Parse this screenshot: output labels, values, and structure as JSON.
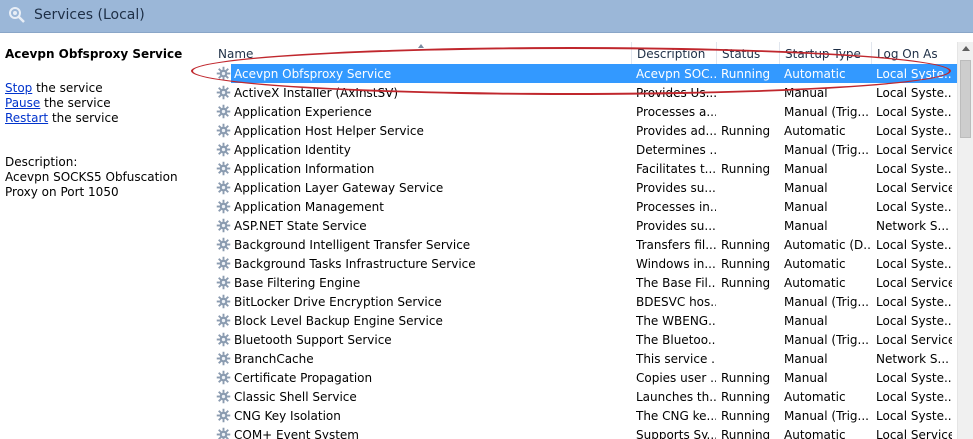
{
  "window": {
    "title": "Services (Local)"
  },
  "left_pane": {
    "heading": "Acevpn Obfsproxy Service",
    "actions": [
      {
        "link": "Stop",
        "rest": " the service"
      },
      {
        "link": "Pause",
        "rest": " the service"
      },
      {
        "link": "Restart",
        "rest": " the service"
      }
    ],
    "description_label": "Description:",
    "description_text": "Acevpn SOCKS5 Obfuscation Proxy on Port 1050"
  },
  "columns": {
    "name": "Name",
    "description": "Description",
    "status": "Status",
    "startup": "Startup Type",
    "logon": "Log On As"
  },
  "services": [
    {
      "name": "Acevpn Obfsproxy Service",
      "description": "Acevpn SOC...",
      "status": "Running",
      "startup": "Automatic",
      "logon": "Local Syste..."
    },
    {
      "name": "ActiveX Installer (AxInstSV)",
      "description": "Provides Us...",
      "status": "",
      "startup": "Manual",
      "logon": "Local Syste..."
    },
    {
      "name": "Application Experience",
      "description": "Processes a...",
      "status": "",
      "startup": "Manual (Trig...",
      "logon": "Local Syste..."
    },
    {
      "name": "Application Host Helper Service",
      "description": "Provides ad...",
      "status": "Running",
      "startup": "Automatic",
      "logon": "Local Syste..."
    },
    {
      "name": "Application Identity",
      "description": "Determines ...",
      "status": "",
      "startup": "Manual (Trig...",
      "logon": "Local Service"
    },
    {
      "name": "Application Information",
      "description": "Facilitates t...",
      "status": "Running",
      "startup": "Manual",
      "logon": "Local Syste..."
    },
    {
      "name": "Application Layer Gateway Service",
      "description": "Provides su...",
      "status": "",
      "startup": "Manual",
      "logon": "Local Service"
    },
    {
      "name": "Application Management",
      "description": "Processes in...",
      "status": "",
      "startup": "Manual",
      "logon": "Local Syste..."
    },
    {
      "name": "ASP.NET State Service",
      "description": "Provides su...",
      "status": "",
      "startup": "Manual",
      "logon": "Network S..."
    },
    {
      "name": "Background Intelligent Transfer Service",
      "description": "Transfers fil...",
      "status": "Running",
      "startup": "Automatic (D...",
      "logon": "Local Syste..."
    },
    {
      "name": "Background Tasks Infrastructure Service",
      "description": "Windows in...",
      "status": "Running",
      "startup": "Automatic",
      "logon": "Local Syste..."
    },
    {
      "name": "Base Filtering Engine",
      "description": "The Base Fil...",
      "status": "Running",
      "startup": "Automatic",
      "logon": "Local Service"
    },
    {
      "name": "BitLocker Drive Encryption Service",
      "description": "BDESVC hos...",
      "status": "",
      "startup": "Manual (Trig...",
      "logon": "Local Syste..."
    },
    {
      "name": "Block Level Backup Engine Service",
      "description": "The WBENG...",
      "status": "",
      "startup": "Manual",
      "logon": "Local Syste..."
    },
    {
      "name": "Bluetooth Support Service",
      "description": "The Bluetoo...",
      "status": "",
      "startup": "Manual (Trig...",
      "logon": "Local Service"
    },
    {
      "name": "BranchCache",
      "description": "This service ...",
      "status": "",
      "startup": "Manual",
      "logon": "Network S..."
    },
    {
      "name": "Certificate Propagation",
      "description": "Copies user ...",
      "status": "Running",
      "startup": "Manual",
      "logon": "Local Syste..."
    },
    {
      "name": "Classic Shell Service",
      "description": "Launches th...",
      "status": "Running",
      "startup": "Automatic",
      "logon": "Local Syste..."
    },
    {
      "name": "CNG Key Isolation",
      "description": "The CNG ke...",
      "status": "Running",
      "startup": "Manual (Trig...",
      "logon": "Local Syste..."
    },
    {
      "name": "COM+ Event System",
      "description": "Supports Sy...",
      "status": "Running",
      "startup": "Automatic",
      "logon": "Local Service"
    }
  ],
  "selected_index": 0,
  "colors": {
    "selection": "#3399ff",
    "titlebar": "#9bb7d8",
    "annotation": "#c0272d",
    "link": "#0033cc"
  }
}
